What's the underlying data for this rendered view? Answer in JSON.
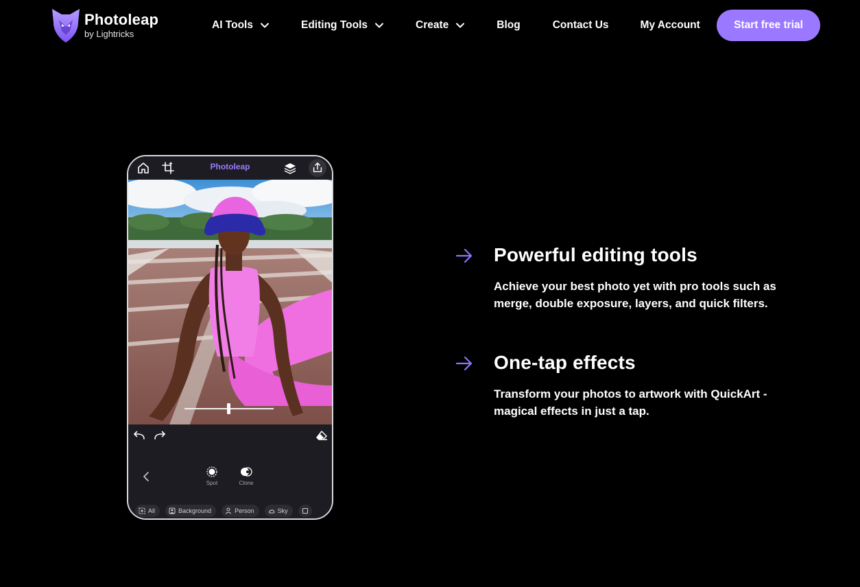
{
  "header": {
    "logo": {
      "title": "Photoleap",
      "subtitle": "by Lightricks"
    },
    "nav": [
      {
        "label": "AI Tools",
        "dropdown": true
      },
      {
        "label": "Editing Tools",
        "dropdown": true
      },
      {
        "label": "Create",
        "dropdown": true
      },
      {
        "label": "Blog",
        "dropdown": false
      },
      {
        "label": "Contact Us",
        "dropdown": false
      },
      {
        "label": "My Account",
        "dropdown": false
      }
    ],
    "cta": "Start free trial"
  },
  "phone": {
    "app_title": "Photoleap",
    "tools": [
      {
        "label": "Spot",
        "icon": "spot-icon"
      },
      {
        "label": "Clone",
        "icon": "clone-icon"
      }
    ],
    "chips": [
      {
        "label": "All",
        "icon": "select-all-icon"
      },
      {
        "label": "Background",
        "icon": "background-icon"
      },
      {
        "label": "Person",
        "icon": "person-icon"
      },
      {
        "label": "Sky",
        "icon": "cloud-icon"
      }
    ]
  },
  "features": [
    {
      "title": "Powerful editing tools",
      "text": "Achieve your best photo yet with pro tools such as merge, double exposure, layers, and quick filters."
    },
    {
      "title": "One-tap effects",
      "text": "Transform your photos to artwork with QuickArt - magical effects in just a tap."
    }
  ],
  "colors": {
    "background": "#000000",
    "accent": "#9a78ff",
    "arrow": "#8f74ff",
    "phone_bg": "#1d1c22"
  }
}
